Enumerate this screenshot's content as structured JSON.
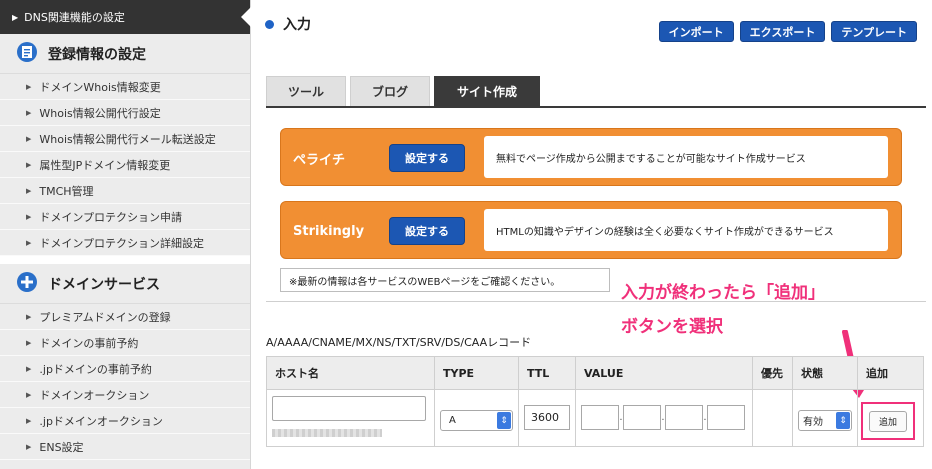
{
  "sidebar": {
    "top_item": "DNS関連機能の設定",
    "sections": [
      {
        "title": "登録情報の設定",
        "icon": "document-stack-icon",
        "items": [
          "ドメインWhois情報変更",
          "Whois情報公開代行設定",
          "Whois情報公開代行メール転送設定",
          "属性型JPドメイン情報変更",
          "TMCH管理",
          "ドメインプロテクション申請",
          "ドメインプロテクション詳細設定"
        ]
      },
      {
        "title": "ドメインサービス",
        "icon": "plus-circle-icon",
        "items": [
          "プレミアムドメインの登録",
          "ドメインの事前予約",
          ".jpドメインの事前予約",
          "ドメインオークション",
          ".jpドメインオークション",
          "ENS設定"
        ]
      }
    ]
  },
  "header": {
    "title": "入力",
    "buttons": [
      "インポート",
      "エクスポート",
      "テンプレート"
    ]
  },
  "tabs": [
    "ツール",
    "ブログ",
    "サイト作成"
  ],
  "active_tab": "サイト作成",
  "services": [
    {
      "name": "ペライチ",
      "button": "設定する",
      "description": "無料でページ作成から公開まですることが可能なサイト作成サービス"
    },
    {
      "name": "Strikingly",
      "button": "設定する",
      "description": "HTMLの知識やデザインの経験は全く必要なくサイト作成ができるサービス"
    }
  ],
  "notice": "※最新の情報は各サービスのWEBページをご確認ください。",
  "annotation": {
    "line1": "入力が終わったら「追加」",
    "line2": "ボタンを選択"
  },
  "records": {
    "label": "A/AAAA/CNAME/MX/NS/TXT/SRV/DS/CAAレコード",
    "columns": [
      "ホスト名",
      "TYPE",
      "TTL",
      "VALUE",
      "優先",
      "状態",
      "追加"
    ],
    "row": {
      "host": "",
      "type": "A",
      "ttl": "3600",
      "status": "有効",
      "add_button": "追加"
    }
  },
  "colors": {
    "accent_blue": "#1c57b3",
    "service_orange": "#f18f33",
    "annotation_pink": "#f0307a",
    "active_tab": "#3a3a3a"
  }
}
